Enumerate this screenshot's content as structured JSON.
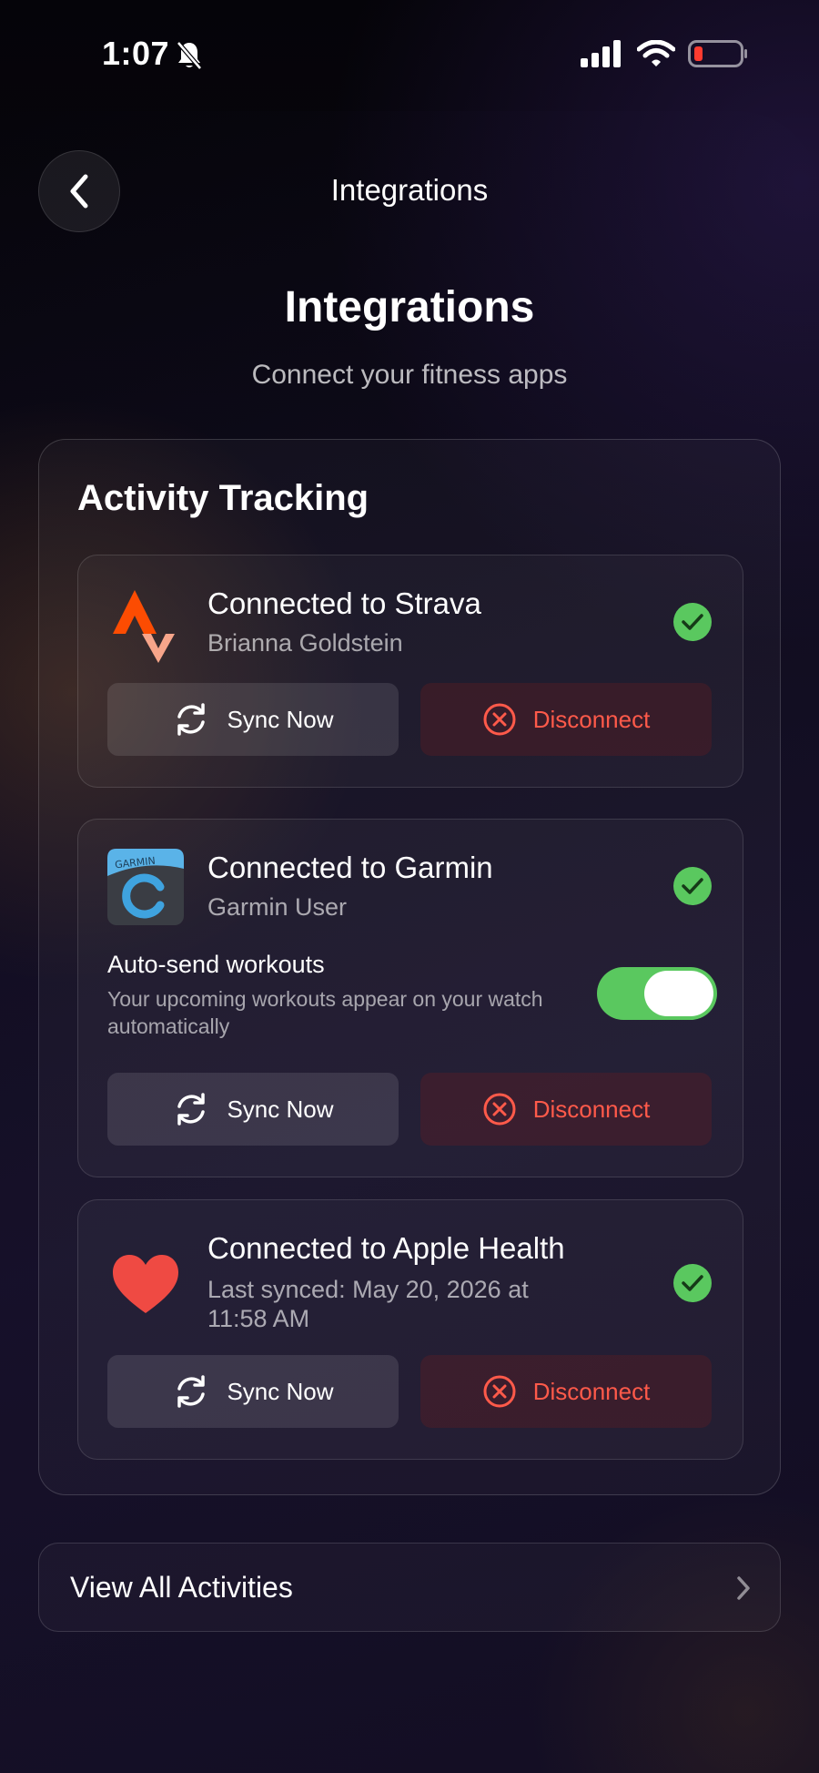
{
  "status_bar": {
    "time": "1:07"
  },
  "nav": {
    "title": "Integrations"
  },
  "header": {
    "title": "Integrations",
    "subtitle": "Connect your fitness apps"
  },
  "section": {
    "title": "Activity Tracking"
  },
  "integrations": [
    {
      "title": "Connected to Strava",
      "subtitle": "Brianna Goldstein",
      "sync_label": "Sync Now",
      "disconnect_label": "Disconnect"
    },
    {
      "title": "Connected to Garmin",
      "subtitle": "Garmin User",
      "logo_text": "GARMIN",
      "auto_send_label": "Auto-send workouts",
      "auto_send_desc": "Your upcoming workouts appear on your watch automatically",
      "auto_send_on": true,
      "sync_label": "Sync Now",
      "disconnect_label": "Disconnect"
    },
    {
      "title": "Connected to Apple Health",
      "subtitle": "Last synced: May 20, 2026 at 11:58 AM",
      "sync_label": "Sync Now",
      "disconnect_label": "Disconnect"
    }
  ],
  "footer": {
    "view_all_label": "View All Activities"
  },
  "colors": {
    "accent_green": "#5ac85f",
    "danger_red": "#ff5a4a",
    "strava_orange": "#fc4c02"
  }
}
